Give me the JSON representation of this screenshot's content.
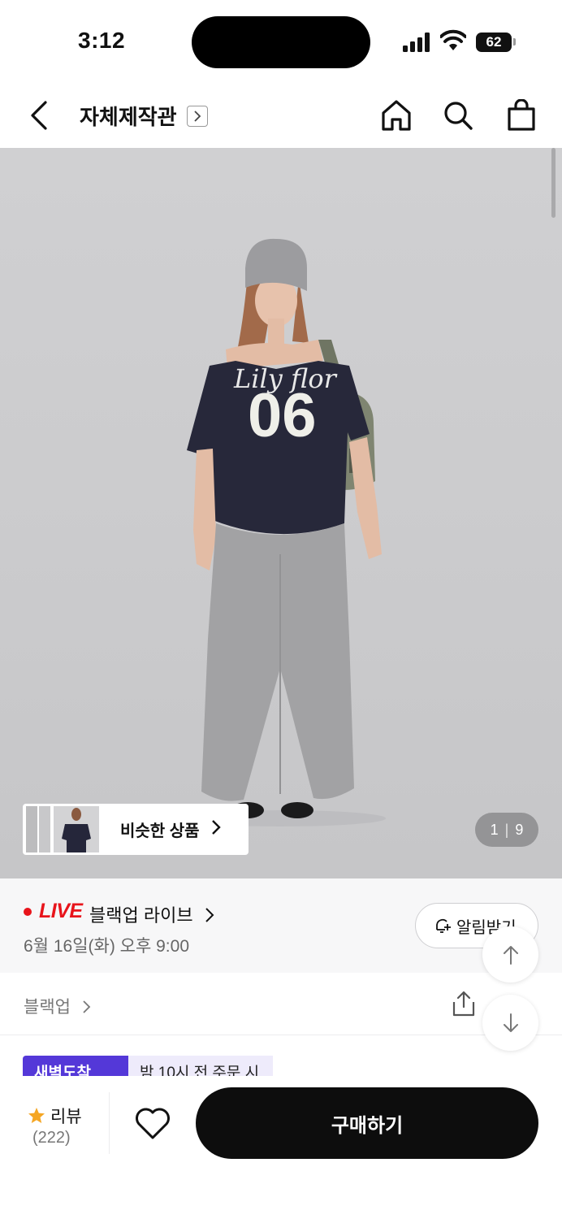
{
  "status_bar": {
    "time": "3:12",
    "battery": "62"
  },
  "header": {
    "title": "자체제작관"
  },
  "hero": {
    "page_current": "1",
    "page_separator": "|",
    "page_total": "9",
    "similar_label": "비슷한 상품",
    "jersey_script": "Lily flor",
    "jersey_number": "06"
  },
  "live": {
    "badge": "LIVE",
    "title": "블랙업 라이브",
    "date": "6월 16일(화) 오후 9:00",
    "notify_label": "알림받기"
  },
  "brand": {
    "name": "블랙업"
  },
  "promo": {
    "badge": "새벽도착",
    "text": "밤 10시 전 주문 시"
  },
  "bottom": {
    "review_label": "리뷰",
    "review_count": "(222)",
    "buy_label": "구매하기"
  },
  "colors": {
    "live_red": "#e8141b",
    "promo_purple": "#5438d8",
    "buy_black": "#0d0d0d",
    "star": "#f5a623"
  }
}
